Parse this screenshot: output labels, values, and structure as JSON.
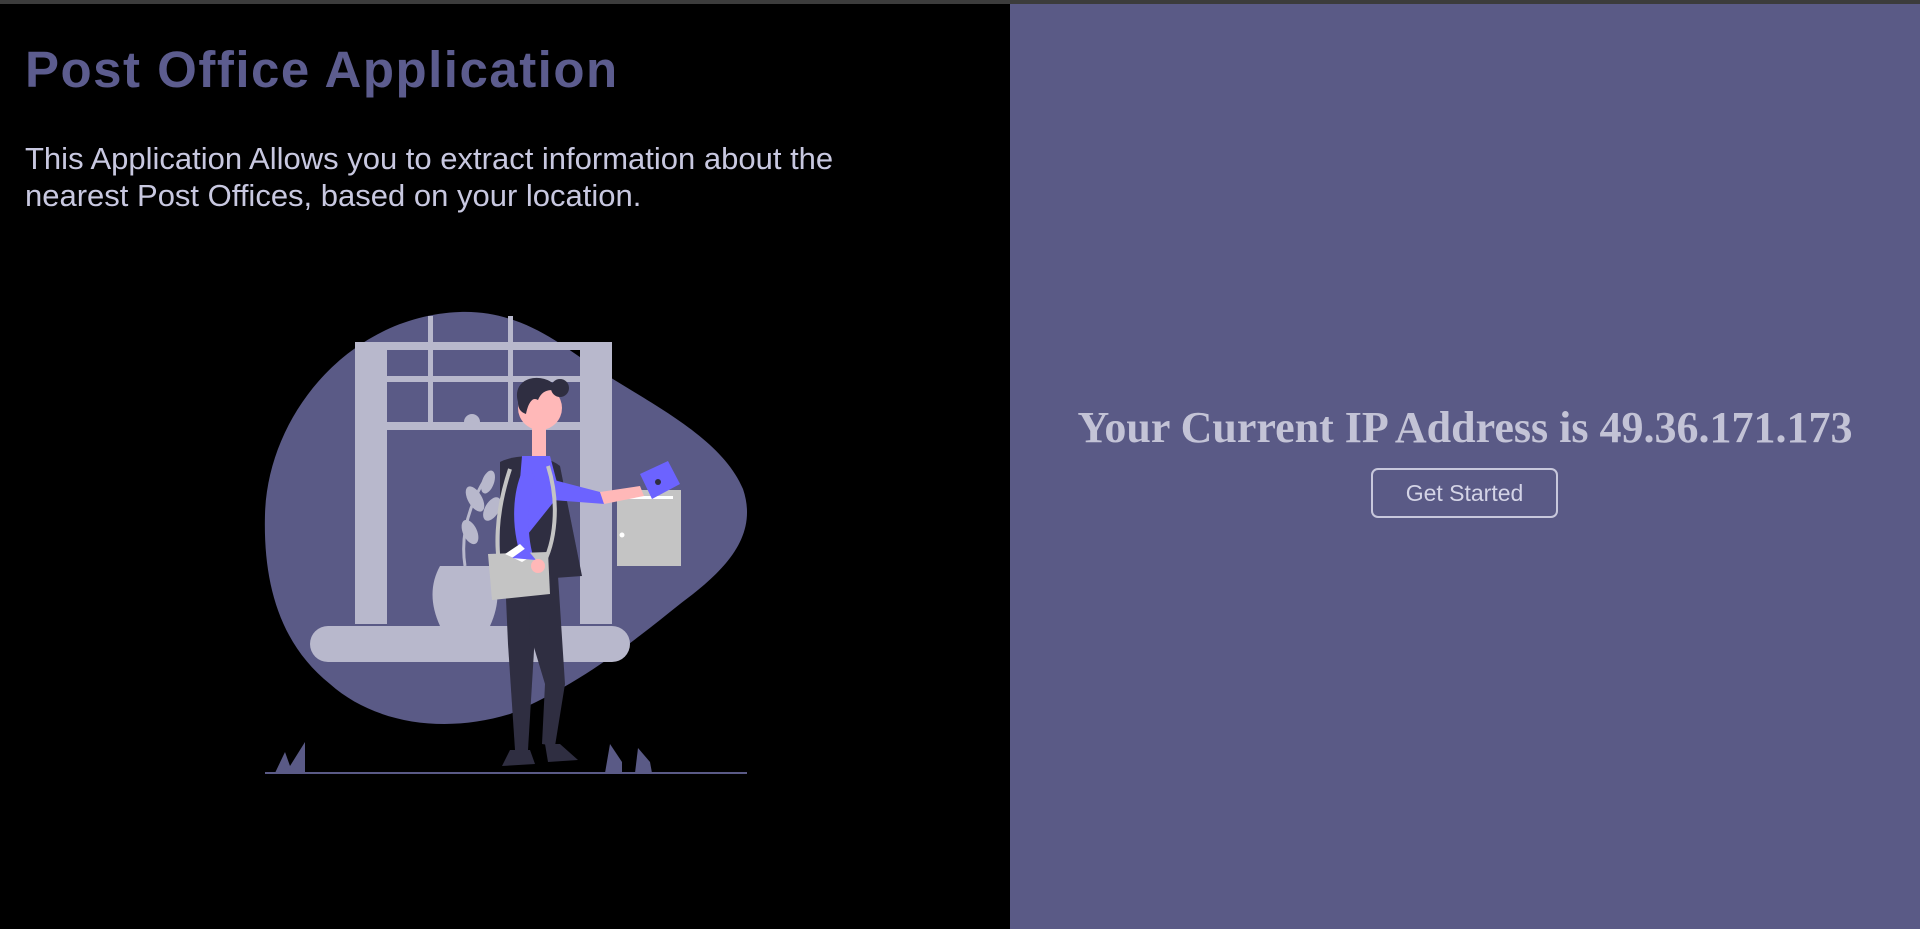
{
  "header": {
    "title": "Post Office Application",
    "description": "This Application Allows you to extract information about the nearest Post Offices, based on your location."
  },
  "ip_section": {
    "prefix": "Your Current IP Address is",
    "ip": "49.36.171.173",
    "button_label": "Get Started"
  },
  "illustration": {
    "name": "mailman-posting-letter"
  },
  "colors": {
    "left_background": "#000000",
    "right_background": "#5a5a86",
    "title": "#5c5c8e",
    "text": "#c8c8e0",
    "accent": "#6c63ff"
  }
}
